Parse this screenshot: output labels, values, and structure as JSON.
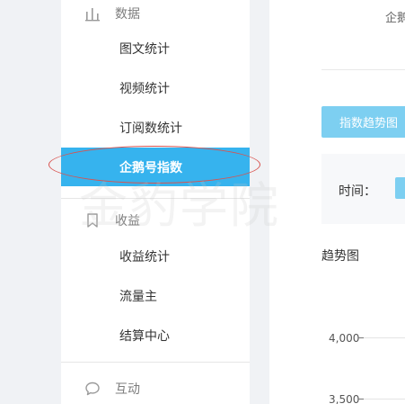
{
  "sidebar": {
    "sections": [
      {
        "label": "数据",
        "icon": "bar-chart-icon",
        "items": [
          "图文统计",
          "视频统计",
          "订阅数统计",
          "企鹅号指数"
        ]
      },
      {
        "label": "收益",
        "icon": "bookmark-icon",
        "items": [
          "收益统计",
          "流量主",
          "结算中心"
        ]
      },
      {
        "label": "互动",
        "icon": "comment-icon",
        "items": []
      }
    ],
    "active_item": "企鹅号指数"
  },
  "main": {
    "top_label": "企鹅",
    "tab_label": "指数趋势图",
    "filter_label": "时间：",
    "chart_title": "趋势图"
  },
  "chart_data": {
    "type": "line",
    "title": "趋势图",
    "y_ticks": [
      "4,000",
      "3,500"
    ]
  },
  "watermark": "金豹学院",
  "colors": {
    "active_bg": "#36b3ee",
    "tab_bg": "#7dcff1",
    "annotation": "#d9534f"
  }
}
